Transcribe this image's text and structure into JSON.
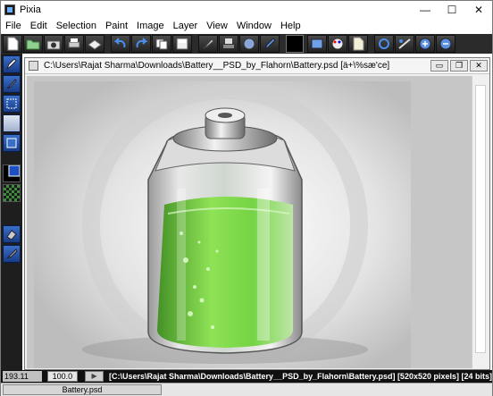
{
  "window": {
    "title": "Pixia",
    "controls": {
      "minimize": "—",
      "maximize": "☐",
      "close": "✕"
    }
  },
  "menu": [
    "File",
    "Edit",
    "Selection",
    "Paint",
    "Image",
    "Layer",
    "View",
    "Window",
    "Help"
  ],
  "toolbar": {
    "buttons": [
      "new-file-icon",
      "open-folder-icon",
      "camera-icon",
      "printer-icon",
      "scanner-icon",
      "undo-icon",
      "redo-icon",
      "copy-icon",
      "save-icon",
      "brush-tool-icon",
      "stamp-icon",
      "sphere-icon",
      "pen-icon",
      "color-swatch",
      "layers-icon",
      "palette-icon",
      "document-icon",
      "rotate-icon",
      "adjust-icon",
      "zoom-in-icon",
      "zoom-out-icon"
    ]
  },
  "side_tools": [
    "pen-tool-icon",
    "brush-tool-icon",
    "rectangle-select-icon",
    "gradient-icon",
    "square-tool-icon",
    "color-picker-icon",
    "pattern-icon",
    "eraser-icon",
    "smudge-icon"
  ],
  "document": {
    "title": "C:\\Users\\Rajat Sharma\\Downloads\\Battery__PSD_by_Flahorn\\Battery.psd [ä+\\%sæ'ce]",
    "controls": {
      "minimize": "▭",
      "restore": "❐",
      "close": "✕"
    }
  },
  "statusbar": {
    "coords": "193.11",
    "zoom": "100.0",
    "zoom_button": "▶",
    "info": "[C:\\Users\\Rajat Sharma\\Downloads\\Battery__PSD_by_Flahorn\\Battery.psd] [520x520 pixels] [24 bits]"
  },
  "taskbar": {
    "item": "Battery.psd"
  },
  "colors": {
    "toolbar_bg": "#2b2b2b",
    "side_bg": "#1e1e1e",
    "battery_green": "#6fd23c",
    "canvas_bg": "#c6c6c6"
  }
}
